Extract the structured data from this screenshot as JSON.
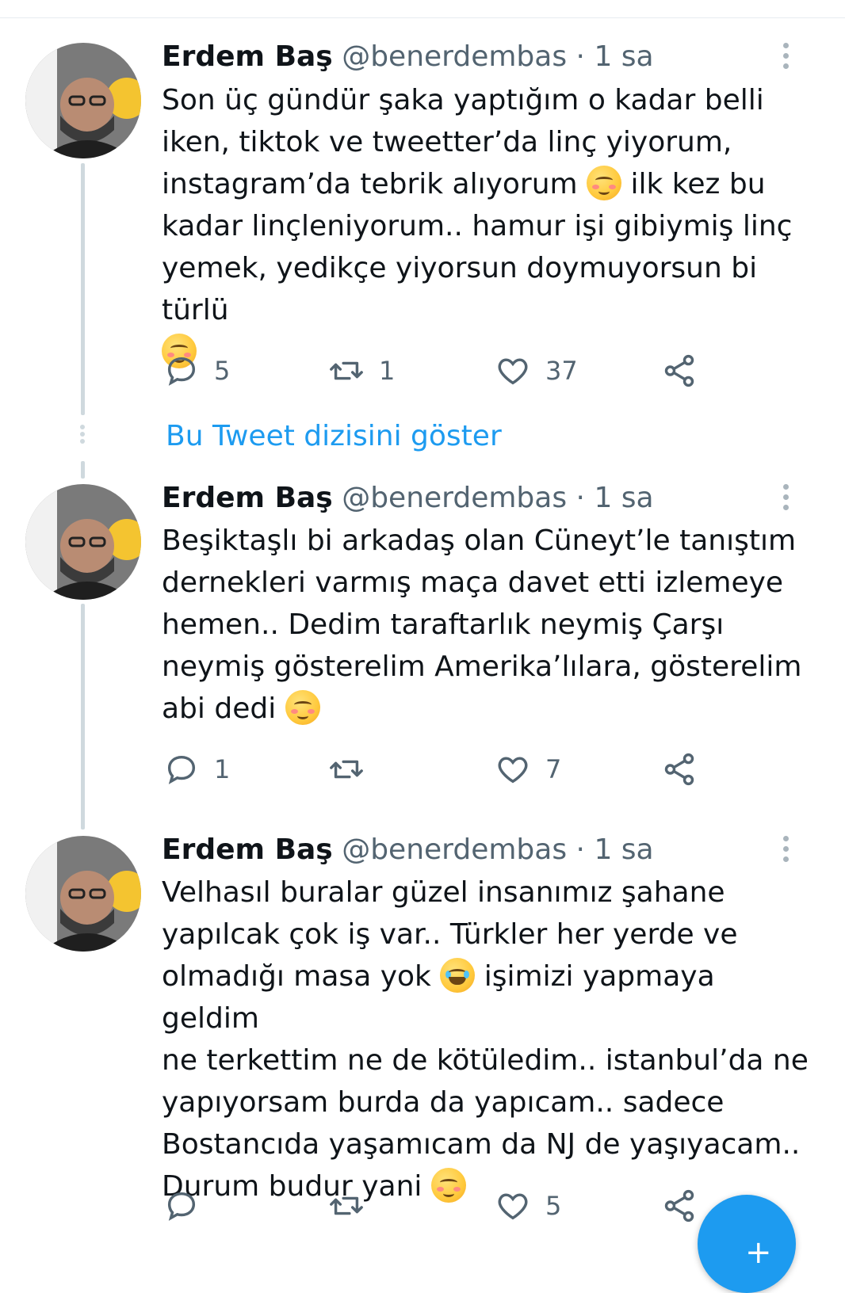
{
  "tweets": [
    {
      "name": "Erdem Baş",
      "handle": "@benerdembas",
      "separator": "·",
      "time": "1 sa",
      "text_parts": [
        "Son üç gündür şaka yaptığım o kadar belli\niken, tiktok ve tweetter’da linç yiyorum,\ninstagram’da tebrik alıyorum ",
        " ilk kez bu\nkadar linçleniyorum.. hamur işi gibiymiş linç\nyemek, yedikçe yiyorsun doymuyorsun bi türlü\n",
        ""
      ],
      "emojis": [
        "smiling-face-with-blush-icon",
        "smiling-face-with-blush-icon"
      ],
      "replies": "5",
      "retweets": "1",
      "likes": "37"
    },
    {
      "name": "Erdem Baş",
      "handle": "@benerdembas",
      "separator": "·",
      "time": "1 sa",
      "text_parts": [
        "Beşiktaşlı bi arkadaş olan Cüneyt’le tanıştım\ndernekleri varmış maça davet etti izlemeye\nhemen.. Dedim taraftarlık neymiş Çarşı\nneymiş gösterelim Amerika’lılara, gösterelim\nabi dedi ",
        ""
      ],
      "emojis": [
        "smiling-face-with-blush-icon"
      ],
      "replies": "1",
      "retweets": "",
      "likes": "7"
    },
    {
      "name": "Erdem Baş",
      "handle": "@benerdembas",
      "separator": "·",
      "time": "1 sa",
      "text_parts": [
        "Velhasıl buralar güzel insanımız şahane\nyapılcak çok iş var.. Türkler her yerde ve\nolmadığı masa yok ",
        " işimizi yapmaya geldim\nne terkettim ne de kötüledim.. istanbul’da ne\nyapıyorsam burda da yapıcam.. sadece\nBostancıda yaşamıcam da NJ de yaşıyacam..\nDurum budur yani ",
        ""
      ],
      "emojis": [
        "face-with-tears-of-joy-icon",
        "smiling-face-with-blush-icon"
      ],
      "replies": "",
      "retweets": "",
      "likes": "5"
    }
  ],
  "show_thread_label": "Bu Tweet dizisini göster",
  "colors": {
    "link": "#1d9bf0",
    "muted": "#536471",
    "thread_line": "#cfd9de"
  }
}
